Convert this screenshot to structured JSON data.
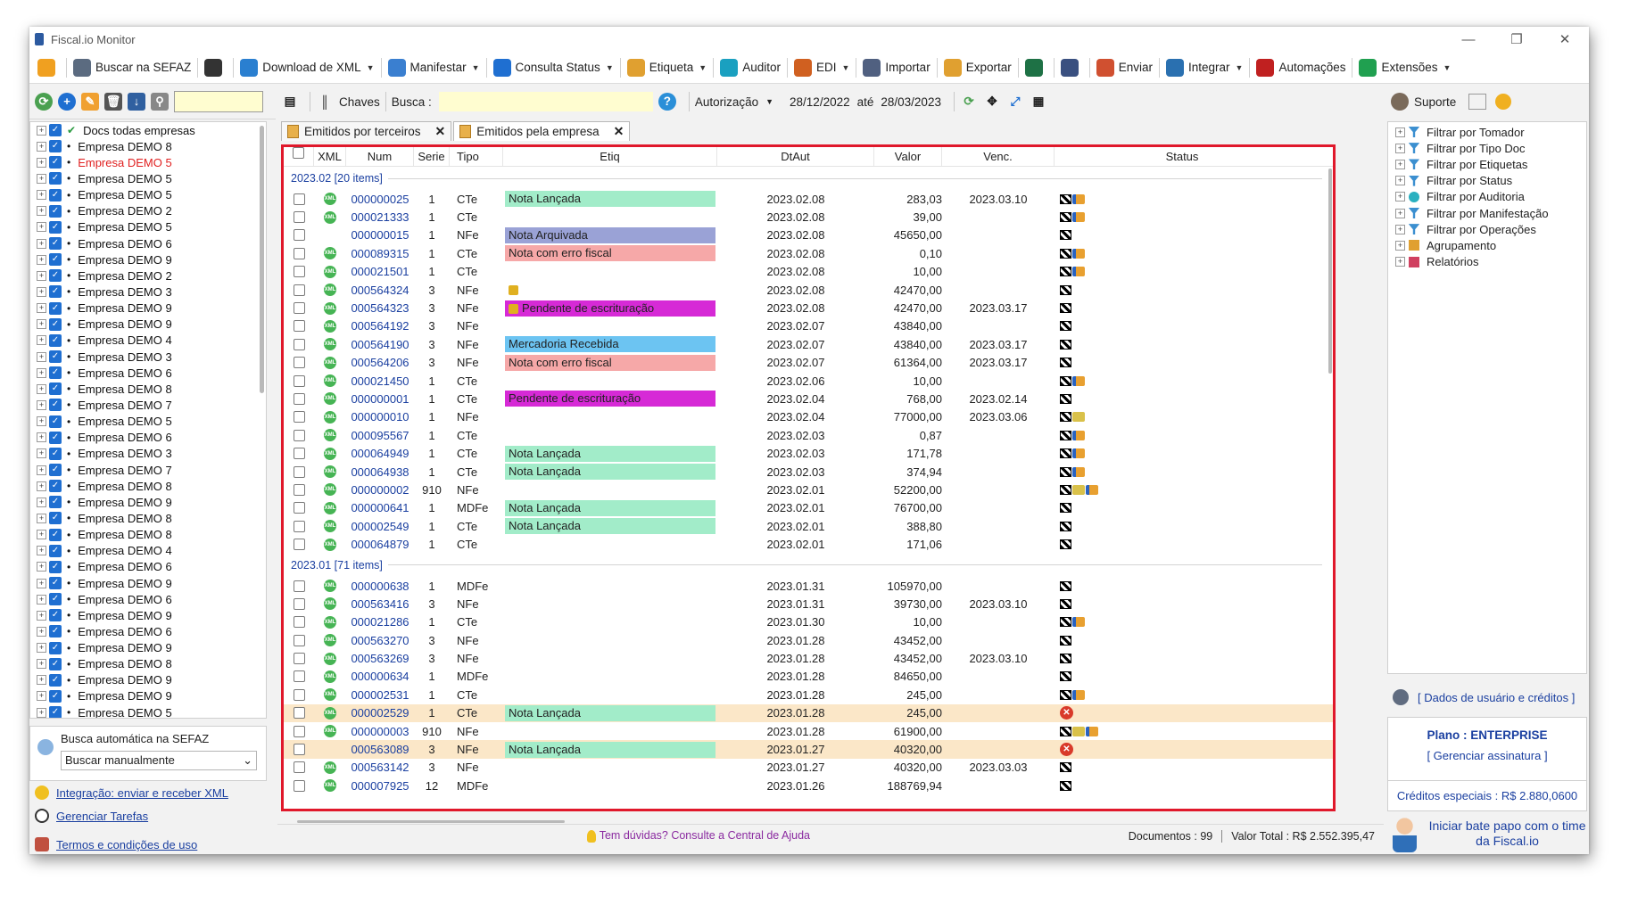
{
  "window": {
    "title": "Fiscal.io Monitor"
  },
  "toolbar": [
    {
      "label": "",
      "icon": "settings-sun-icon",
      "color": "#f0a020"
    },
    {
      "label": "Buscar na SEFAZ",
      "icon": "cloud-search-icon",
      "color": "#5b6b80"
    },
    {
      "label": "",
      "icon": "document-list-icon",
      "color": "#333333"
    },
    {
      "label": "Download de XML",
      "icon": "xml-download-icon",
      "color": "#2a7fd0",
      "caret": true
    },
    {
      "label": "Manifestar",
      "icon": "manifest-icon",
      "color": "#3a7fd0",
      "caret": true
    },
    {
      "label": "Consulta Status",
      "icon": "check-status-icon",
      "color": "#1f6fd1",
      "caret": true
    },
    {
      "label": "Etiqueta",
      "icon": "tag-icon",
      "color": "#e0a030",
      "caret": true
    },
    {
      "label": "Auditor",
      "icon": "auditor-icon",
      "color": "#1aa0c0"
    },
    {
      "label": "EDI",
      "icon": "truck-icon",
      "color": "#d06020",
      "caret": true
    },
    {
      "label": "Importar",
      "icon": "import-icon",
      "color": "#506080"
    },
    {
      "label": "Exportar",
      "icon": "export-icon",
      "color": "#e0a030"
    },
    {
      "label": "",
      "icon": "excel-icon",
      "color": "#1e7145"
    },
    {
      "label": "",
      "icon": "print-icon",
      "color": "#3a5080"
    },
    {
      "label": "Enviar",
      "icon": "email-icon",
      "color": "#d05030"
    },
    {
      "label": "Integrar",
      "icon": "integrate-icon",
      "color": "#2a70b0",
      "caret": true
    },
    {
      "label": "Automações",
      "icon": "automation-icon",
      "color": "#c02020"
    },
    {
      "label": "Extensões",
      "icon": "extensions-icon",
      "color": "#20a050",
      "caret": true
    }
  ],
  "left": {
    "tree": [
      {
        "label": "Docs todas empresas",
        "red": false,
        "root": true
      },
      {
        "label": "Empresa DEMO 8",
        "red": false
      },
      {
        "label": "Empresa DEMO 5",
        "red": true
      },
      {
        "label": "Empresa DEMO 5",
        "red": false
      },
      {
        "label": "Empresa DEMO 5",
        "red": false
      },
      {
        "label": "Empresa DEMO 2",
        "red": false
      },
      {
        "label": "Empresa DEMO 5",
        "red": false
      },
      {
        "label": "Empresa DEMO 6",
        "red": false
      },
      {
        "label": "Empresa DEMO 9",
        "red": false
      },
      {
        "label": "Empresa DEMO 2",
        "red": false
      },
      {
        "label": "Empresa DEMO 3",
        "red": false
      },
      {
        "label": "Empresa DEMO 9",
        "red": false
      },
      {
        "label": "Empresa DEMO 9",
        "red": false
      },
      {
        "label": "Empresa DEMO 4",
        "red": false
      },
      {
        "label": "Empresa DEMO 3",
        "red": false
      },
      {
        "label": "Empresa DEMO 6",
        "red": false
      },
      {
        "label": "Empresa DEMO 8",
        "red": false
      },
      {
        "label": "Empresa DEMO 7",
        "red": false
      },
      {
        "label": "Empresa DEMO 5",
        "red": false
      },
      {
        "label": "Empresa DEMO 6",
        "red": false
      },
      {
        "label": "Empresa DEMO 3",
        "red": false
      },
      {
        "label": "Empresa DEMO 7",
        "red": false
      },
      {
        "label": "Empresa DEMO 8",
        "red": false
      },
      {
        "label": "Empresa DEMO 9",
        "red": false
      },
      {
        "label": "Empresa DEMO 8",
        "red": false
      },
      {
        "label": "Empresa DEMO 8",
        "red": false
      },
      {
        "label": "Empresa DEMO 4",
        "red": false
      },
      {
        "label": "Empresa DEMO 6",
        "red": false
      },
      {
        "label": "Empresa DEMO 9",
        "red": false
      },
      {
        "label": "Empresa DEMO 6",
        "red": false
      },
      {
        "label": "Empresa DEMO 9",
        "red": false
      },
      {
        "label": "Empresa DEMO 6",
        "red": false
      },
      {
        "label": "Empresa DEMO 9",
        "red": false
      },
      {
        "label": "Empresa DEMO 8",
        "red": false
      },
      {
        "label": "Empresa DEMO 9",
        "red": false
      },
      {
        "label": "Empresa DEMO 9",
        "red": false
      },
      {
        "label": "Empresa DEMO 5",
        "red": false
      }
    ],
    "auto_search_label": "Busca automática na SEFAZ",
    "auto_search_value": "Buscar manualmente",
    "link_integracao": "Integração: enviar e receber XML",
    "link_tarefas": "Gerenciar Tarefas",
    "link_termos": "Termos e condições de uso"
  },
  "filter": {
    "chaves": "Chaves",
    "busca": "Busca :",
    "autorizacao": "Autorização",
    "date_from": "28/12/2022",
    "ate": "até",
    "date_to": "28/03/2023"
  },
  "tabs": [
    {
      "label": "Emitidos por terceiros",
      "active": false
    },
    {
      "label": "Emitidos pela empresa",
      "active": true
    }
  ],
  "grid": {
    "headers": {
      "xml": "XML",
      "num": "Num",
      "serie": "Serie",
      "tipo": "Tipo",
      "etiq": "Etiq",
      "dtaut": "DtAut",
      "valor": "Valor",
      "venc": "Venc.",
      "status": "Status"
    },
    "tag_colors": {
      "Nota Lançada": "#a2ecc9",
      "Nota Arquivada": "#9aa2d6",
      "Nota com erro fiscal": "#f6a8a8",
      "Pendente de escrituração": "#d62ad6",
      "Mercadoria Recebida": "#6cc4f2"
    },
    "groups": [
      {
        "label": "2023.02 [20 items]",
        "rows": [
          {
            "xml": true,
            "num": "000000025",
            "serie": "1",
            "tipo": "CTe",
            "etiq": "Nota Lançada",
            "dt": "2023.02.08",
            "valor": "283,03",
            "venc": "2023.03.10",
            "status": [
              "flag",
              "truck"
            ]
          },
          {
            "xml": true,
            "num": "000021333",
            "serie": "1",
            "tipo": "CTe",
            "etiq": "",
            "dt": "2023.02.08",
            "valor": "39,00",
            "venc": "",
            "status": [
              "flag",
              "truck"
            ]
          },
          {
            "xml": false,
            "num": "000000015",
            "serie": "1",
            "tipo": "NFe",
            "etiq": "Nota Arquivada",
            "dt": "2023.02.08",
            "valor": "45650,00",
            "venc": "",
            "status": [
              "flag"
            ]
          },
          {
            "xml": true,
            "num": "000089315",
            "serie": "1",
            "tipo": "CTe",
            "etiq": "Nota com erro fiscal",
            "dt": "2023.02.08",
            "valor": "0,10",
            "venc": "",
            "status": [
              "flag",
              "truck"
            ]
          },
          {
            "xml": true,
            "num": "000021501",
            "serie": "1",
            "tipo": "CTe",
            "etiq": "",
            "dt": "2023.02.08",
            "valor": "10,00",
            "venc": "",
            "status": [
              "flag",
              "truck"
            ]
          },
          {
            "xml": true,
            "num": "000564324",
            "serie": "3",
            "tipo": "NFe",
            "etiq": "",
            "etiq_icon": true,
            "dt": "2023.02.08",
            "valor": "42470,00",
            "venc": "",
            "status": [
              "flag"
            ]
          },
          {
            "xml": true,
            "num": "000564323",
            "serie": "3",
            "tipo": "NFe",
            "etiq": "Pendente de escrituração",
            "etiq_icon": true,
            "dt": "2023.02.08",
            "valor": "42470,00",
            "venc": "2023.03.17",
            "status": [
              "flag"
            ]
          },
          {
            "xml": true,
            "num": "000564192",
            "serie": "3",
            "tipo": "NFe",
            "etiq": "",
            "dt": "2023.02.07",
            "valor": "43840,00",
            "venc": "",
            "status": [
              "flag"
            ]
          },
          {
            "xml": true,
            "num": "000564190",
            "serie": "3",
            "tipo": "NFe",
            "etiq": "Mercadoria Recebida",
            "dt": "2023.02.07",
            "valor": "43840,00",
            "venc": "2023.03.17",
            "status": [
              "flag"
            ]
          },
          {
            "xml": true,
            "num": "000564206",
            "serie": "3",
            "tipo": "NFe",
            "etiq": "Nota com erro fiscal",
            "dt": "2023.02.07",
            "valor": "61364,00",
            "venc": "2023.03.17",
            "status": [
              "flag"
            ]
          },
          {
            "xml": true,
            "num": "000021450",
            "serie": "1",
            "tipo": "CTe",
            "etiq": "",
            "dt": "2023.02.06",
            "valor": "10,00",
            "venc": "",
            "status": [
              "flag",
              "truck"
            ]
          },
          {
            "xml": true,
            "num": "000000001",
            "serie": "1",
            "tipo": "CTe",
            "etiq": "Pendente de escrituração",
            "dt": "2023.02.04",
            "valor": "768,00",
            "venc": "2023.02.14",
            "status": [
              "flag"
            ]
          },
          {
            "xml": true,
            "num": "000000010",
            "serie": "1",
            "tipo": "NFe",
            "etiq": "",
            "dt": "2023.02.04",
            "valor": "77000,00",
            "venc": "2023.03.06",
            "status": [
              "flag",
              "bill"
            ]
          },
          {
            "xml": true,
            "num": "000095567",
            "serie": "1",
            "tipo": "CTe",
            "etiq": "",
            "dt": "2023.02.03",
            "valor": "0,87",
            "venc": "",
            "status": [
              "flag",
              "truck"
            ]
          },
          {
            "xml": true,
            "num": "000064949",
            "serie": "1",
            "tipo": "CTe",
            "etiq": "Nota Lançada",
            "dt": "2023.02.03",
            "valor": "171,78",
            "venc": "",
            "status": [
              "flag",
              "truck"
            ]
          },
          {
            "xml": true,
            "num": "000064938",
            "serie": "1",
            "tipo": "CTe",
            "etiq": "Nota Lançada",
            "dt": "2023.02.03",
            "valor": "374,94",
            "venc": "",
            "status": [
              "flag",
              "truck"
            ]
          },
          {
            "xml": true,
            "num": "000000002",
            "serie": "910",
            "tipo": "NFe",
            "etiq": "",
            "dt": "2023.02.01",
            "valor": "52200,00",
            "venc": "",
            "status": [
              "flag",
              "bill",
              "truck"
            ]
          },
          {
            "xml": true,
            "num": "000000641",
            "serie": "1",
            "tipo": "MDFe",
            "etiq": "Nota Lançada",
            "dt": "2023.02.01",
            "valor": "76700,00",
            "venc": "",
            "status": [
              "flag"
            ]
          },
          {
            "xml": true,
            "num": "000002549",
            "serie": "1",
            "tipo": "CTe",
            "etiq": "Nota Lançada",
            "dt": "2023.02.01",
            "valor": "388,80",
            "venc": "",
            "status": [
              "flag"
            ]
          },
          {
            "xml": true,
            "num": "000064879",
            "serie": "1",
            "tipo": "CTe",
            "etiq": "",
            "dt": "2023.02.01",
            "valor": "171,06",
            "venc": "",
            "status": [
              "flag"
            ]
          }
        ]
      },
      {
        "label": "2023.01 [71 items]",
        "rows": [
          {
            "xml": true,
            "num": "000000638",
            "serie": "1",
            "tipo": "MDFe",
            "etiq": "",
            "dt": "2023.01.31",
            "valor": "105970,00",
            "venc": "",
            "status": [
              "flag"
            ]
          },
          {
            "xml": true,
            "num": "000563416",
            "serie": "3",
            "tipo": "NFe",
            "etiq": "",
            "dt": "2023.01.31",
            "valor": "39730,00",
            "venc": "2023.03.10",
            "status": [
              "flag"
            ]
          },
          {
            "xml": true,
            "num": "000021286",
            "serie": "1",
            "tipo": "CTe",
            "etiq": "",
            "dt": "2023.01.30",
            "valor": "10,00",
            "venc": "",
            "status": [
              "flag",
              "truck"
            ]
          },
          {
            "xml": true,
            "num": "000563270",
            "serie": "3",
            "tipo": "NFe",
            "etiq": "",
            "dt": "2023.01.28",
            "valor": "43452,00",
            "venc": "",
            "status": [
              "flag"
            ]
          },
          {
            "xml": true,
            "num": "000563269",
            "serie": "3",
            "tipo": "NFe",
            "etiq": "",
            "dt": "2023.01.28",
            "valor": "43452,00",
            "venc": "2023.03.10",
            "status": [
              "flag"
            ]
          },
          {
            "xml": true,
            "num": "000000634",
            "serie": "1",
            "tipo": "MDFe",
            "etiq": "",
            "dt": "2023.01.28",
            "valor": "84650,00",
            "venc": "",
            "status": [
              "flag"
            ]
          },
          {
            "xml": true,
            "num": "000002531",
            "serie": "1",
            "tipo": "CTe",
            "etiq": "",
            "dt": "2023.01.28",
            "valor": "245,00",
            "venc": "",
            "status": [
              "flag",
              "truck"
            ]
          },
          {
            "xml": true,
            "num": "000002529",
            "serie": "1",
            "tipo": "CTe",
            "etiq": "Nota Lançada",
            "dt": "2023.01.28",
            "valor": "245,00",
            "venc": "",
            "status": [
              "error"
            ],
            "highlight": true
          },
          {
            "xml": true,
            "num": "000000003",
            "serie": "910",
            "tipo": "NFe",
            "etiq": "",
            "dt": "2023.01.28",
            "valor": "61900,00",
            "venc": "",
            "status": [
              "flag",
              "bill",
              "truck"
            ]
          },
          {
            "xml": false,
            "num": "000563089",
            "serie": "3",
            "tipo": "NFe",
            "etiq": "Nota Lançada",
            "dt": "2023.01.27",
            "valor": "40320,00",
            "venc": "",
            "status": [
              "error"
            ],
            "highlight": true
          },
          {
            "xml": true,
            "num": "000563142",
            "serie": "3",
            "tipo": "NFe",
            "etiq": "",
            "dt": "2023.01.27",
            "valor": "40320,00",
            "venc": "2023.03.03",
            "status": [
              "flag"
            ]
          },
          {
            "xml": true,
            "num": "000007925",
            "serie": "12",
            "tipo": "MDFe",
            "etiq": "",
            "dt": "2023.01.26",
            "valor": "188769,94",
            "venc": "",
            "status": [
              "flag"
            ]
          }
        ]
      }
    ]
  },
  "statusbar": {
    "help": "Tem dúvidas? Consulte a Central de Ajuda",
    "docs": "Documentos : 99",
    "total": "Valor Total : R$ 2.552.395,47"
  },
  "right": {
    "suporte": "Suporte",
    "filters": [
      "Filtrar por Tomador",
      "Filtrar por Tipo Doc",
      "Filtrar por Etiquetas",
      "Filtrar por Status",
      "Filtrar por Auditoria",
      "Filtrar por Manifestação",
      "Filtrar por Operações",
      "Agrupamento",
      "Relatórios"
    ],
    "user_link": "[ Dados de usuário e créditos ]",
    "plan": "Plano : ENTERPRISE",
    "manage": "[ Gerenciar assinatura ]",
    "credits": "Créditos especiais : R$ 2.880,0600",
    "chat": "Iniciar bate papo com o time da Fiscal.io"
  }
}
